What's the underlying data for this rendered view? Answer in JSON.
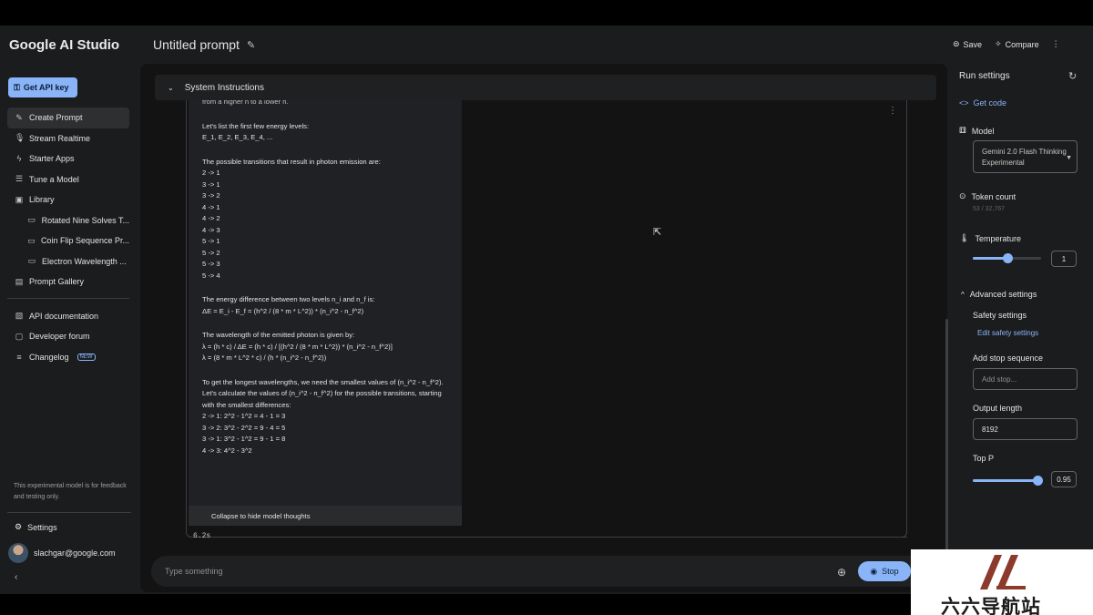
{
  "app": {
    "name": "Google AI Studio"
  },
  "header": {
    "title": "Untitled prompt",
    "save_label": "Save",
    "compare_label": "Compare"
  },
  "sidebar": {
    "api_key_label": "Get API key",
    "items": [
      {
        "label": "Create Prompt",
        "icon": "create-prompt-icon"
      },
      {
        "label": "Stream Realtime",
        "icon": "mic-icon"
      },
      {
        "label": "Starter Apps",
        "icon": "bolt-icon"
      },
      {
        "label": "Tune a Model",
        "icon": "tune-icon"
      },
      {
        "label": "Library",
        "icon": "library-icon"
      },
      {
        "label": "Rotated Nine Solves T...",
        "icon": "chat-icon"
      },
      {
        "label": "Coin Flip Sequence Pr...",
        "icon": "chat-icon"
      },
      {
        "label": "Electron Wavelength ...",
        "icon": "chat-icon"
      },
      {
        "label": "Prompt Gallery",
        "icon": "gallery-icon"
      },
      {
        "label": "API documentation",
        "icon": "docs-icon"
      },
      {
        "label": "Developer forum",
        "icon": "forum-icon"
      },
      {
        "label": "Changelog",
        "icon": "changelog-icon",
        "badge": "NEW"
      }
    ],
    "experimental_note": "This experimental model is for feedback and testing only.",
    "settings_label": "Settings",
    "user_email": "slachgar@google.com"
  },
  "main": {
    "system_instructions_label": "System Instructions",
    "thoughts": [
      "from a higher n to a lower n.",
      "Let's list the first few energy levels:\nE_1, E_2, E_3, E_4, ...",
      "The possible transitions that result in photon emission are:\n2 -> 1\n3 -> 1\n3 -> 2\n4 -> 1\n4 -> 2\n4 -> 3\n5 -> 1\n5 -> 2\n5 -> 3\n5 -> 4",
      "The energy difference between two levels n_i and n_f is:\nΔE = E_i - E_f = (h^2 / (8 * m * L^2)) * (n_i^2 - n_f^2)",
      "The wavelength of the emitted photon is given by:\nλ = (h * c) / ΔE = (h * c) / [(h^2 / (8 * m * L^2)) * (n_i^2 - n_f^2)]\nλ = (8 * m * L^2 * c) / (h * (n_i^2 - n_f^2))",
      "To get the longest wavelengths, we need the smallest values of (n_i^2 - n_f^2).\nLet's calculate the values of (n_i^2 - n_f^2) for the possible transitions, starting with the smallest differences:\n2 -> 1: 2^2 - 1^2 = 4 - 1 = 3\n3 -> 2: 3^2 - 2^2 = 9 - 4 = 5\n3 -> 1: 3^2 - 1^2 = 9 - 1 = 8\n4 -> 3: 4^2 - 3^2"
    ],
    "collapse_label": "Collapse to hide model thoughts",
    "elapsed": "6.2s",
    "input_placeholder": "Type something",
    "stop_label": "Stop"
  },
  "run_settings": {
    "title": "Run settings",
    "get_code_label": "Get code",
    "model_label": "Model",
    "model_value": "Gemini 2.0 Flash Thinking Experimental",
    "token_count_label": "Token count",
    "token_count_value": "53 / 32,767",
    "temperature_label": "Temperature",
    "temperature_value": "1",
    "temperature_fraction": 0.5,
    "advanced_label": "Advanced settings",
    "safety_label": "Safety settings",
    "safety_link": "Edit safety settings",
    "stop_seq_label": "Add stop sequence",
    "stop_seq_placeholder": "Add stop...",
    "output_length_label": "Output length",
    "output_length_value": "8192",
    "top_p_label": "Top P",
    "top_p_value": "0.95",
    "top_p_fraction": 0.95
  },
  "watermark": {
    "text": "六六导航站"
  },
  "colors": {
    "accent": "#8ab4f8",
    "background": "#1b1c1d",
    "panel": "#131314"
  }
}
